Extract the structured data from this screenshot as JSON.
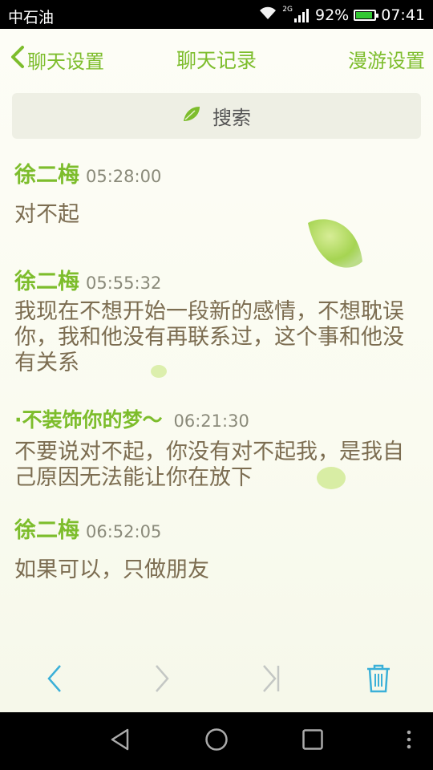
{
  "status_bar": {
    "carrier": "中石油",
    "network": "2G",
    "battery_percent": "92%",
    "battery_level": 0.92,
    "time": "07:41"
  },
  "header": {
    "back_label": "聊天设置",
    "title": "聊天记录",
    "roaming_label": "漫游设置"
  },
  "search": {
    "label": "搜索",
    "icon": "leaf-icon"
  },
  "messages": [
    {
      "sender": "徐二梅",
      "time": "05:28:00",
      "text": "对不起"
    },
    {
      "sender": "徐二梅",
      "time": "05:55:32",
      "text": "我现在不想开始一段新的感情，不想耽误你，我和他没有再联系过，这个事和他没有关系"
    },
    {
      "sender": "·不装饰你的梦～",
      "time": "06:21:30",
      "text": "不要说对不起，你没有对不起我，是我自己原因无法能让你在放下"
    },
    {
      "sender": "徐二梅",
      "time": "06:52:05",
      "text": "如果可以，只做朋友"
    }
  ],
  "toolbar": {
    "icons": [
      "chevron-left-icon",
      "chevron-right-icon",
      "skip-to-end-icon",
      "trash-icon"
    ]
  },
  "navbar": {
    "icons": [
      "back-triangle-icon",
      "home-circle-icon",
      "recents-square-icon",
      "more-dots-icon"
    ]
  },
  "colors": {
    "accent": "#7dbd2c",
    "message_text": "#7c6d51",
    "toolbar_icon": "#3bb0d8"
  }
}
